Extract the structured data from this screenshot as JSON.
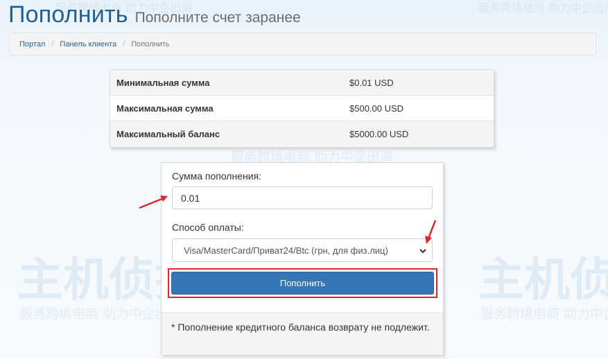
{
  "header": {
    "title": "Пополнить",
    "subtitle": "Пополните счет заранее"
  },
  "breadcrumb": {
    "items": [
      "Портал",
      "Панель клиента"
    ],
    "active": "Пополнить"
  },
  "limits": {
    "rows": [
      {
        "label": "Минимальная сумма",
        "value": "$0.01 USD"
      },
      {
        "label": "Максимальная сумма",
        "value": "$500.00 USD"
      },
      {
        "label": "Максимальный баланс",
        "value": "$5000.00 USD"
      }
    ]
  },
  "form": {
    "amount_label": "Сумма пополнения:",
    "amount_value": "0.01",
    "method_label": "Способ оплаты:",
    "method_selected": "Visa/MasterCard/Приват24/Btc (грн, для физ.лиц)",
    "submit_label": "Пополнить",
    "note": "* Пополнение кредитного баланса возврату не подлежит."
  },
  "watermark": {
    "brand": "主机侦探",
    "slogan": "服务跨境电商 助力中企出海"
  },
  "colors": {
    "accent": "#1f5f94",
    "button": "#3776b6",
    "highlight": "#e0262b"
  }
}
